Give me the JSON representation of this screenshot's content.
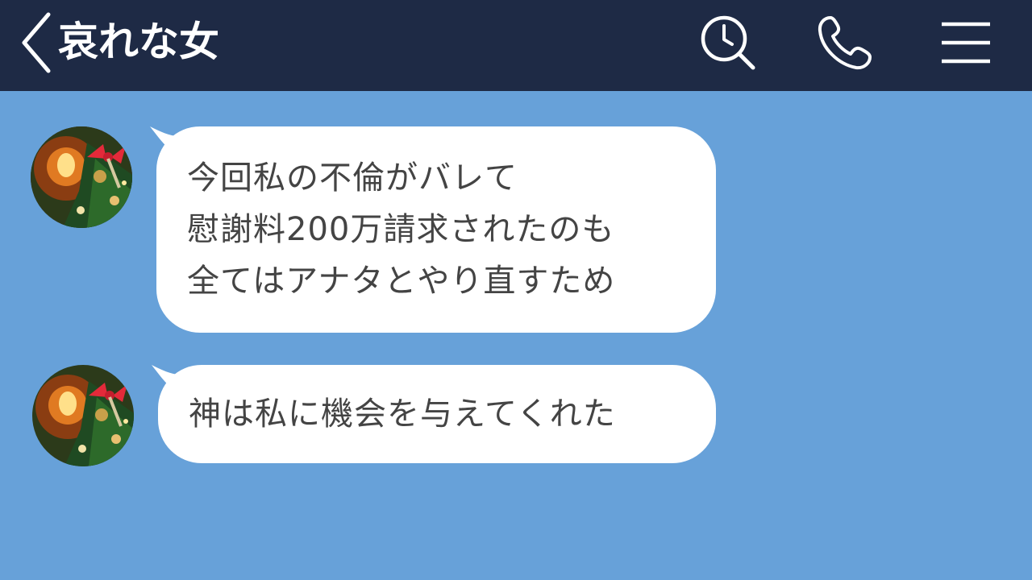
{
  "header": {
    "title": "哀れな女",
    "back_icon": "chevron-left-icon",
    "search_icon": "search-icon",
    "call_icon": "phone-icon",
    "menu_icon": "hamburger-menu-icon",
    "background_color": "#1e2a45"
  },
  "chat": {
    "background_color": "#67a1d9",
    "messages": [
      {
        "avatar_icon": "christmas-tree-avatar-icon",
        "lines": [
          "今回私の不倫がバレて",
          "慰謝料200万請求されたのも",
          "全てはアナタとやり直すため"
        ]
      },
      {
        "avatar_icon": "christmas-tree-avatar-icon",
        "lines": [
          "神は私に機会を与えてくれた"
        ]
      }
    ]
  }
}
